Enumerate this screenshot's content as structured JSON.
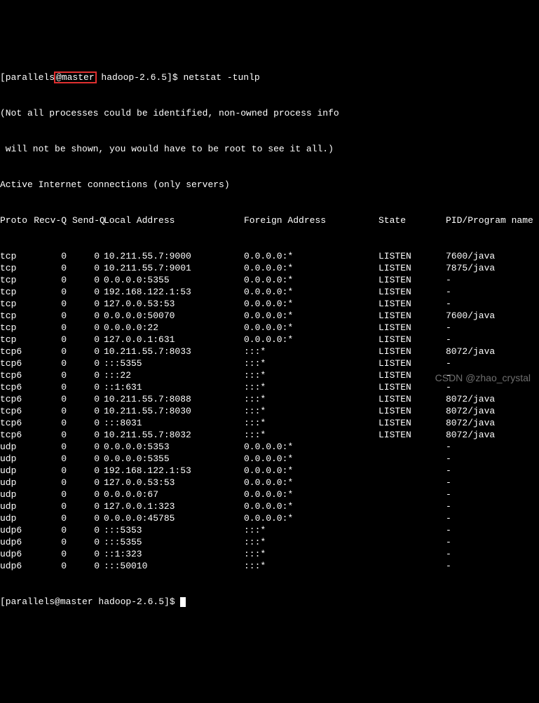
{
  "prompt1": {
    "user_open": "[parallels",
    "at_host": "@master",
    "path_close": " hadoop-2.6.5]$ ",
    "command": "netstat -tunlp"
  },
  "info_line1": "(Not all processes could be identified, non-owned process info",
  "info_line2": " will not be shown, you would have to be root to see it all.)",
  "heading": "Active Internet connections (only servers)",
  "headers": {
    "proto": "Proto",
    "recvq": "Recv-Q",
    "sendq": "Send-Q",
    "local": "Local Address",
    "foreign": "Foreign Address",
    "state": "State",
    "pid": "PID/Program name"
  },
  "rows": [
    {
      "proto": "tcp",
      "recvq": "0",
      "sendq": "0",
      "local": "10.211.55.7:9000",
      "foreign": "0.0.0.0:*",
      "state": "LISTEN",
      "pid": "7600/java"
    },
    {
      "proto": "tcp",
      "recvq": "0",
      "sendq": "0",
      "local": "10.211.55.7:9001",
      "foreign": "0.0.0.0:*",
      "state": "LISTEN",
      "pid": "7875/java"
    },
    {
      "proto": "tcp",
      "recvq": "0",
      "sendq": "0",
      "local": "0.0.0.0:5355",
      "foreign": "0.0.0.0:*",
      "state": "LISTEN",
      "pid": "-"
    },
    {
      "proto": "tcp",
      "recvq": "0",
      "sendq": "0",
      "local": "192.168.122.1:53",
      "foreign": "0.0.0.0:*",
      "state": "LISTEN",
      "pid": "-"
    },
    {
      "proto": "tcp",
      "recvq": "0",
      "sendq": "0",
      "local": "127.0.0.53:53",
      "foreign": "0.0.0.0:*",
      "state": "LISTEN",
      "pid": "-"
    },
    {
      "proto": "tcp",
      "recvq": "0",
      "sendq": "0",
      "local": "0.0.0.0:50070",
      "foreign": "0.0.0.0:*",
      "state": "LISTEN",
      "pid": "7600/java"
    },
    {
      "proto": "tcp",
      "recvq": "0",
      "sendq": "0",
      "local": "0.0.0.0:22",
      "foreign": "0.0.0.0:*",
      "state": "LISTEN",
      "pid": "-"
    },
    {
      "proto": "tcp",
      "recvq": "0",
      "sendq": "0",
      "local": "127.0.0.1:631",
      "foreign": "0.0.0.0:*",
      "state": "LISTEN",
      "pid": "-"
    },
    {
      "proto": "tcp6",
      "recvq": "0",
      "sendq": "0",
      "local": "10.211.55.7:8033",
      "foreign": ":::*",
      "state": "LISTEN",
      "pid": "8072/java"
    },
    {
      "proto": "tcp6",
      "recvq": "0",
      "sendq": "0",
      "local": ":::5355",
      "foreign": ":::*",
      "state": "LISTEN",
      "pid": "-"
    },
    {
      "proto": "tcp6",
      "recvq": "0",
      "sendq": "0",
      "local": ":::22",
      "foreign": ":::*",
      "state": "LISTEN",
      "pid": "-"
    },
    {
      "proto": "tcp6",
      "recvq": "0",
      "sendq": "0",
      "local": "::1:631",
      "foreign": ":::*",
      "state": "LISTEN",
      "pid": "-"
    },
    {
      "proto": "tcp6",
      "recvq": "0",
      "sendq": "0",
      "local": "10.211.55.7:8088",
      "foreign": ":::*",
      "state": "LISTEN",
      "pid": "8072/java"
    },
    {
      "proto": "tcp6",
      "recvq": "0",
      "sendq": "0",
      "local": "10.211.55.7:8030",
      "foreign": ":::*",
      "state": "LISTEN",
      "pid": "8072/java"
    },
    {
      "proto": "tcp6",
      "recvq": "0",
      "sendq": "0",
      "local": ":::8031",
      "foreign": ":::*",
      "state": "LISTEN",
      "pid": "8072/java"
    },
    {
      "proto": "tcp6",
      "recvq": "0",
      "sendq": "0",
      "local": "10.211.55.7:8032",
      "foreign": ":::*",
      "state": "LISTEN",
      "pid": "8072/java"
    },
    {
      "proto": "udp",
      "recvq": "0",
      "sendq": "0",
      "local": "0.0.0.0:5353",
      "foreign": "0.0.0.0:*",
      "state": "",
      "pid": "-"
    },
    {
      "proto": "udp",
      "recvq": "0",
      "sendq": "0",
      "local": "0.0.0.0:5355",
      "foreign": "0.0.0.0:*",
      "state": "",
      "pid": "-"
    },
    {
      "proto": "udp",
      "recvq": "0",
      "sendq": "0",
      "local": "192.168.122.1:53",
      "foreign": "0.0.0.0:*",
      "state": "",
      "pid": "-"
    },
    {
      "proto": "udp",
      "recvq": "0",
      "sendq": "0",
      "local": "127.0.0.53:53",
      "foreign": "0.0.0.0:*",
      "state": "",
      "pid": "-"
    },
    {
      "proto": "udp",
      "recvq": "0",
      "sendq": "0",
      "local": "0.0.0.0:67",
      "foreign": "0.0.0.0:*",
      "state": "",
      "pid": "-"
    },
    {
      "proto": "udp",
      "recvq": "0",
      "sendq": "0",
      "local": "127.0.0.1:323",
      "foreign": "0.0.0.0:*",
      "state": "",
      "pid": "-"
    },
    {
      "proto": "udp",
      "recvq": "0",
      "sendq": "0",
      "local": "0.0.0.0:45785",
      "foreign": "0.0.0.0:*",
      "state": "",
      "pid": "-"
    },
    {
      "proto": "udp6",
      "recvq": "0",
      "sendq": "0",
      "local": ":::5353",
      "foreign": ":::*",
      "state": "",
      "pid": "-"
    },
    {
      "proto": "udp6",
      "recvq": "0",
      "sendq": "0",
      "local": ":::5355",
      "foreign": ":::*",
      "state": "",
      "pid": "-"
    },
    {
      "proto": "udp6",
      "recvq": "0",
      "sendq": "0",
      "local": "::1:323",
      "foreign": ":::*",
      "state": "",
      "pid": "-"
    },
    {
      "proto": "udp6",
      "recvq": "0",
      "sendq": "0",
      "local": ":::50010",
      "foreign": ":::*",
      "state": "",
      "pid": "-"
    }
  ],
  "prompt2": "[parallels@master hadoop-2.6.5]$ ",
  "watermark": "CSDN @zhao_crystal"
}
